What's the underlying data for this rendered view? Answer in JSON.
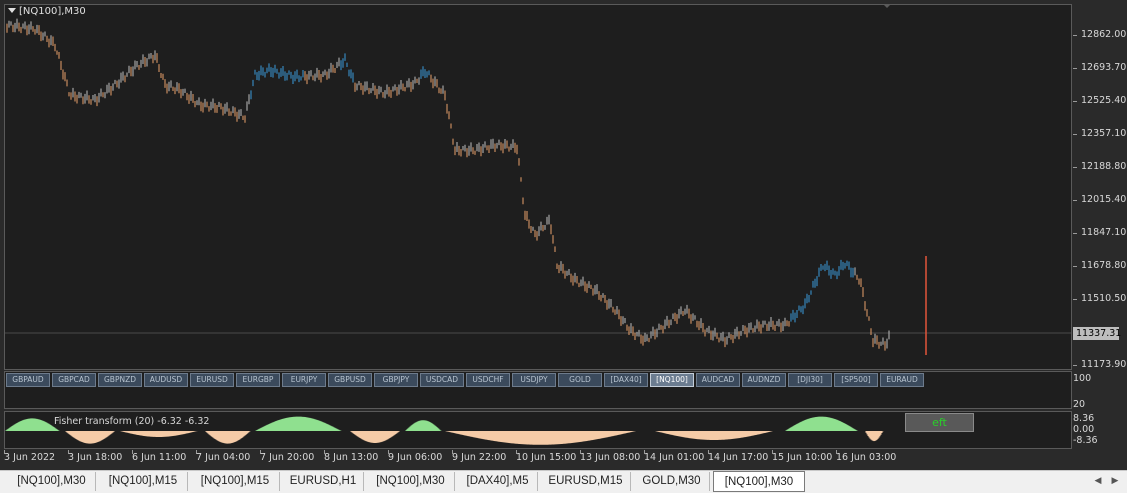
{
  "chart": {
    "title": "[NQ100],M30",
    "current_price": "11337.31",
    "price_axis": [
      "12862.00",
      "12693.70",
      "12525.40",
      "12357.10",
      "12188.80",
      "12015.40",
      "11847.10",
      "11678.80",
      "11510.50",
      "11173.90"
    ],
    "osc_axis": [
      "100",
      "20"
    ],
    "fisher_axis": [
      "8.36",
      "0.00",
      "-8.36"
    ],
    "fisher_label": "Fisher transform (20) -6.32 -6.32",
    "eft_label": "eft",
    "time_axis": [
      "3 Jun 2022",
      "3 Jun 18:00",
      "6 Jun 11:00",
      "7 Jun 04:00",
      "7 Jun 20:00",
      "8 Jun 13:00",
      "9 Jun 06:00",
      "9 Jun 22:00",
      "10 Jun 15:00",
      "13 Jun 08:00",
      "14 Jun 01:00",
      "14 Jun 17:00",
      "15 Jun 10:00",
      "16 Jun 03:00"
    ]
  },
  "symbol_buttons": [
    {
      "label": "GBPAUD",
      "active": false
    },
    {
      "label": "GBPCAD",
      "active": false
    },
    {
      "label": "GBPNZD",
      "active": false
    },
    {
      "label": "AUDUSD",
      "active": false
    },
    {
      "label": "EURUSD",
      "active": false
    },
    {
      "label": "EURGBP",
      "active": false
    },
    {
      "label": "EURJPY",
      "active": false
    },
    {
      "label": "GBPUSD",
      "active": false
    },
    {
      "label": "GBPJPY",
      "active": false
    },
    {
      "label": "USDCAD",
      "active": false
    },
    {
      "label": "USDCHF",
      "active": false
    },
    {
      "label": "USDJPY",
      "active": false
    },
    {
      "label": "GOLD",
      "active": false
    },
    {
      "label": "[DAX40]",
      "active": false
    },
    {
      "label": "[NQ100]",
      "active": true
    },
    {
      "label": "AUDCAD",
      "active": false
    },
    {
      "label": "AUDNZD",
      "active": false
    },
    {
      "label": "[DJI30]",
      "active": false
    },
    {
      "label": "[SP500]",
      "active": false
    },
    {
      "label": "EURAUD",
      "active": false
    }
  ],
  "tabs": [
    {
      "label": "[NQ100],M30",
      "active": false
    },
    {
      "label": "[NQ100],M15",
      "active": false
    },
    {
      "label": "[NQ100],M15",
      "active": false
    },
    {
      "label": "EURUSD,H1",
      "active": false
    },
    {
      "label": "[NQ100],M30",
      "active": false
    },
    {
      "label": "[DAX40],M5",
      "active": false
    },
    {
      "label": "EURUSD,M15",
      "active": false
    },
    {
      "label": "GOLD,M30",
      "active": false
    },
    {
      "label": "[NQ100],M30",
      "active": true
    }
  ],
  "colors": {
    "up": "#3a9ad9",
    "down": "#e8a06a",
    "neutral": "#bdbdbd",
    "hist_pos": "#8fe08f",
    "hist_neg": "#f5cba7",
    "spike": "#e2553a"
  }
}
